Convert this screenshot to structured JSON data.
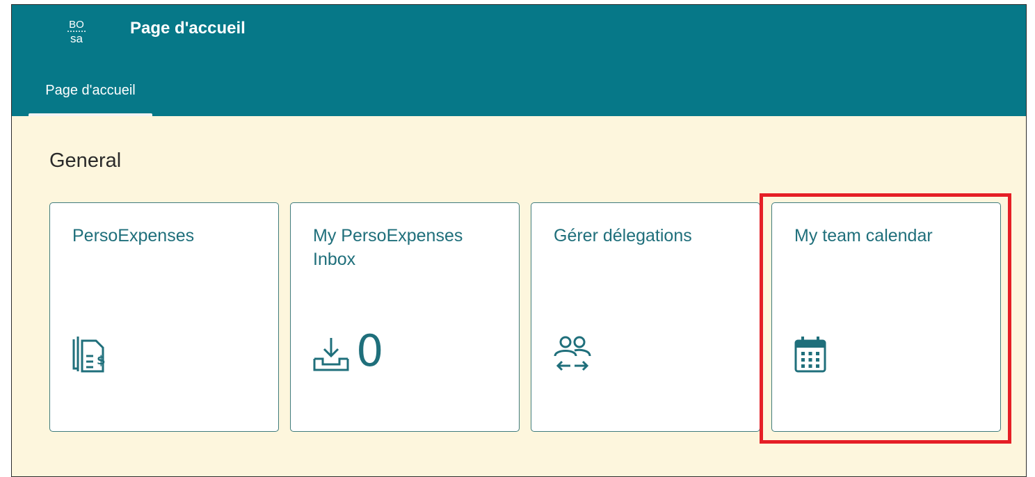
{
  "shellbar": {
    "logo_text_top": "BO",
    "logo_text_bottom": "sa",
    "title": "Page d'accueil",
    "background_color": "#067888"
  },
  "tabs": [
    {
      "label": "Page d'accueil",
      "selected": true
    }
  ],
  "group": {
    "title": "General",
    "tiles": [
      {
        "title": "PersoExpenses",
        "icon": "expense-report-icon"
      },
      {
        "title": "My PersoExpenses Inbox",
        "icon": "inbox-download-icon",
        "count": "0"
      },
      {
        "title": "Gérer délegations",
        "icon": "delegation-icon"
      },
      {
        "title": "My team calendar",
        "icon": "calendar-icon",
        "highlighted": true
      }
    ]
  },
  "colors": {
    "content_background": "#fdf6dd",
    "tile_text": "#1f6f7b",
    "highlight": "#e51f26"
  }
}
